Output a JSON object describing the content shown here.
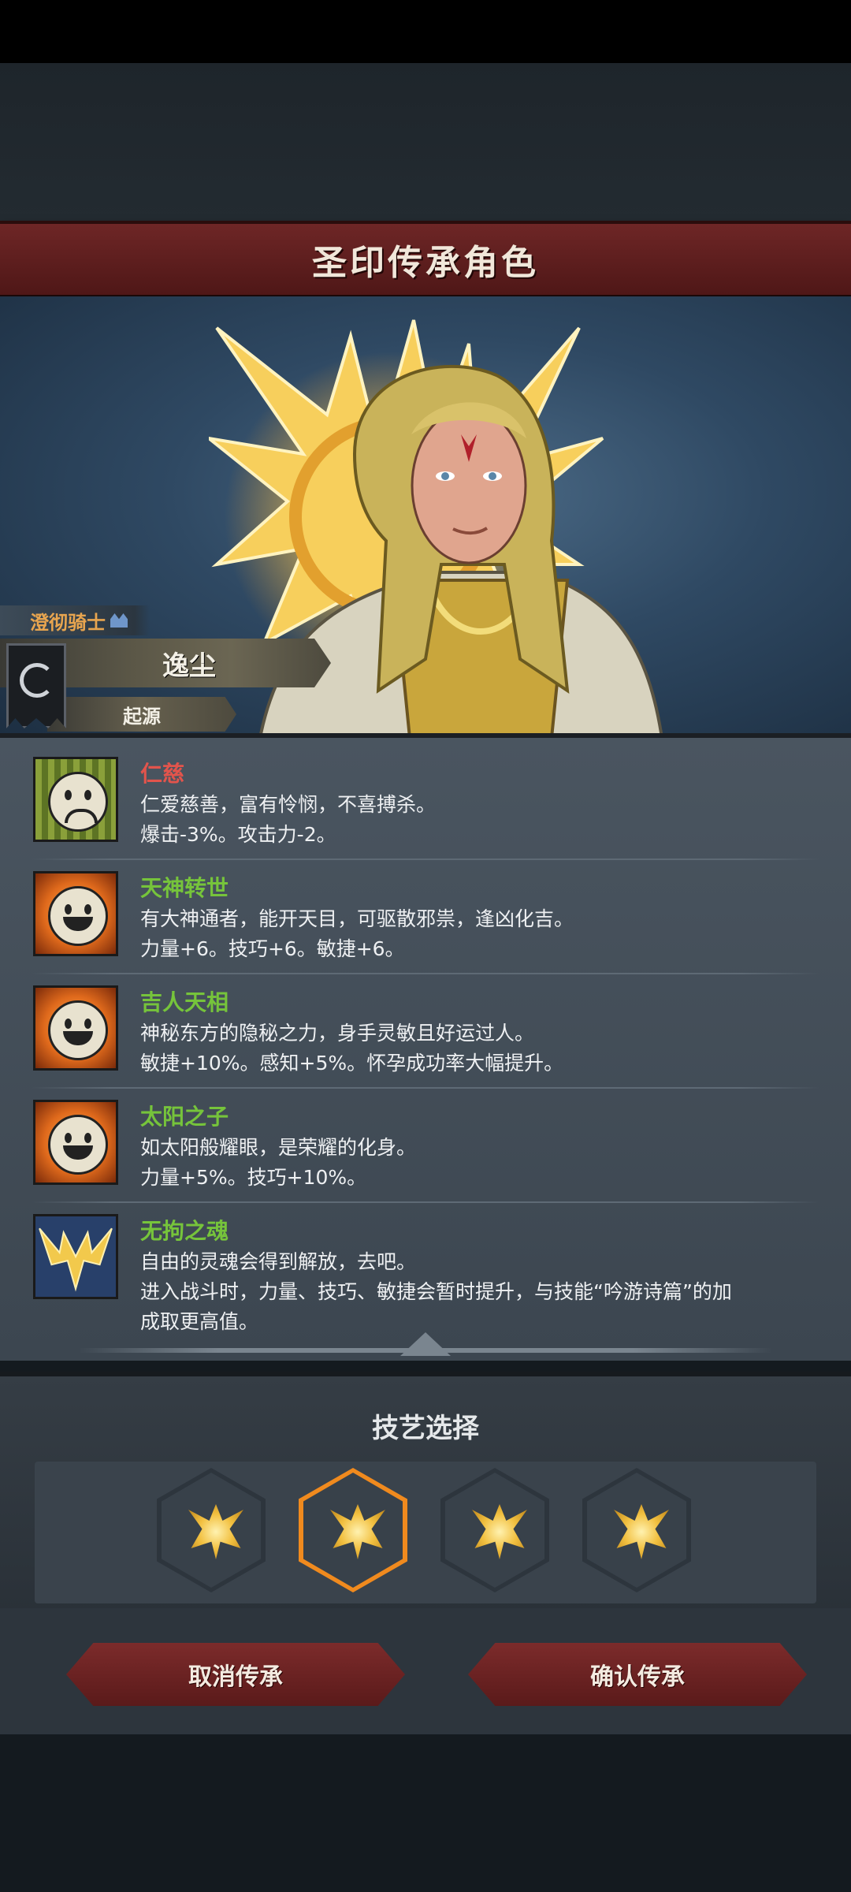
{
  "header": {
    "title": "圣印传承角色"
  },
  "character": {
    "class_label": "澄彻骑士",
    "name": "逸尘",
    "origin_label": "起源"
  },
  "traits": [
    {
      "name": "仁慈",
      "color": "#e2544c",
      "icon": "sad-face-icon",
      "desc_line1": "仁爱慈善，富有怜悯，不喜搏杀。",
      "desc_line2": "爆击-3%。攻击力-2。"
    },
    {
      "name": "天神转世",
      "color": "#76c43b",
      "icon": "happy-face-icon",
      "desc_line1": "有大神通者，能开天目，可驱散邪祟，逢凶化吉。",
      "desc_line2": "力量+6。技巧+6。敏捷+6。"
    },
    {
      "name": "吉人天相",
      "color": "#76c43b",
      "icon": "happy-face-icon",
      "desc_line1": "神秘东方的隐秘之力，身手灵敏且好运过人。",
      "desc_line2": "敏捷+10%。感知+5%。怀孕成功率大幅提升。"
    },
    {
      "name": "太阳之子",
      "color": "#76c43b",
      "icon": "happy-face-icon",
      "desc_line1": "如太阳般耀眼，是荣耀的化身。",
      "desc_line2": "力量+5%。技巧+10%。"
    },
    {
      "name": "无拘之魂",
      "color": "#76c43b",
      "icon": "soul-emblem-icon",
      "desc_line1": "自由的灵魂会得到解放，去吧。",
      "desc_line2": "进入战斗时，力量、技巧、敏捷会暂时提升，与技能“吟游诗篇”的加",
      "desc_line3": "成取更高值。"
    }
  ],
  "skill_select": {
    "title": "技艺选择",
    "selected_index": 1,
    "options": [
      "golden-emblem-icon",
      "golden-emblem-icon",
      "golden-emblem-icon",
      "golden-emblem-icon"
    ]
  },
  "buttons": {
    "cancel": "取消传承",
    "confirm": "确认传承"
  }
}
